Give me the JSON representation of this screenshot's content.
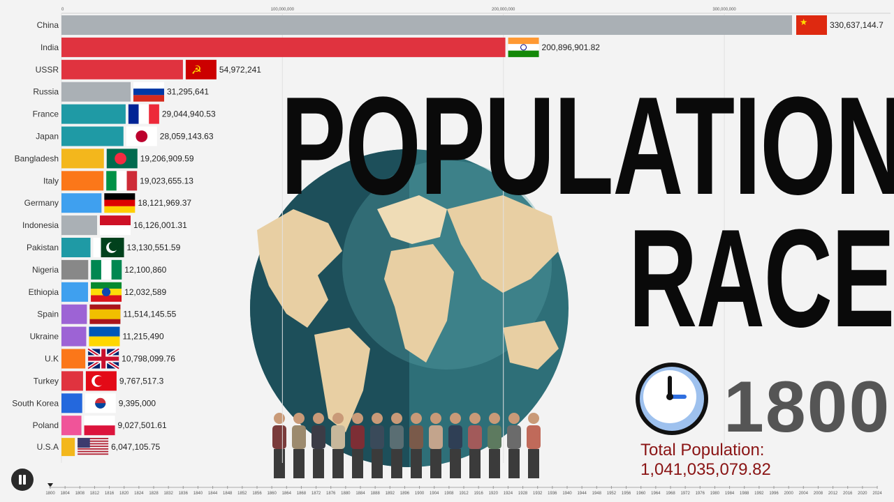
{
  "title": {
    "line1": "POPULATION",
    "line2": "RACE"
  },
  "year": "1800",
  "total_population": "Total Population: 1,041,035,079.82",
  "controls": {
    "pause_icon": "pause-icon"
  },
  "colors": {
    "grey": "#aab0b5",
    "red": "#e0333f",
    "teal": "#1f9aa5",
    "yellow": "#f3b71c",
    "orange": "#fb7719",
    "blue": "#3fa0ef",
    "purple": "#9d63d5",
    "pink": "#f05499",
    "darkgrey": "#888888",
    "royal": "#2468dd"
  },
  "chart_data": {
    "type": "bar",
    "orientation": "horizontal",
    "xlim": [
      0,
      370000000
    ],
    "x_ticks": [
      "0",
      "100,000,000",
      "200,000,000",
      "300,000,000"
    ],
    "timeline_years": [
      "1800",
      "1804",
      "1808",
      "1812",
      "1816",
      "1820",
      "1824",
      "1828",
      "1832",
      "1836",
      "1840",
      "1844",
      "1848",
      "1852",
      "1856",
      "1860",
      "1864",
      "1868",
      "1872",
      "1876",
      "1880",
      "1884",
      "1888",
      "1892",
      "1896",
      "1900",
      "1904",
      "1908",
      "1912",
      "1916",
      "1920",
      "1924",
      "1928",
      "1932",
      "1936",
      "1940",
      "1944",
      "1948",
      "1952",
      "1956",
      "1960",
      "1964",
      "1968",
      "1972",
      "1976",
      "1980",
      "1984",
      "1988",
      "1992",
      "1996",
      "2000",
      "2004",
      "2008",
      "2012",
      "2016",
      "2020",
      "2024"
    ],
    "categories": [
      "China",
      "India",
      "USSR",
      "Russia",
      "France",
      "Japan",
      "Bangladesh",
      "Italy",
      "Germany",
      "Indonesia",
      "Pakistan",
      "Nigeria",
      "Ethiopia",
      "Spain",
      "Ukraine",
      "U.K",
      "Turkey",
      "South Korea",
      "Poland",
      "U.S.A"
    ],
    "values": [
      330637144.7,
      200896901.82,
      54972241,
      31295641,
      29044940.53,
      28059143.63,
      19206909.59,
      19023655.13,
      18121969.37,
      16126001.31,
      13130551.59,
      12100860,
      12032589,
      11514145.55,
      11215490,
      10798099.76,
      9767517.3,
      9395000,
      9027501.61,
      6047105.75
    ],
    "value_labels": [
      "330,637,144.7",
      "200,896,901.82",
      "54,972,241",
      "31,295,641",
      "29,044,940.53",
      "28,059,143.63",
      "19,206,909.59",
      "19,023,655.13",
      "18,121,969.37",
      "16,126,001.31",
      "13,130,551.59",
      "12,100,860",
      "12,032,589",
      "11,514,145.55",
      "11,215,490",
      "10,798,099.76",
      "9,767,517.3",
      "9,395,000",
      "9,027,501.61",
      "6,047,105.75"
    ],
    "bar_colors": [
      "#aab0b5",
      "#e0333f",
      "#e0333f",
      "#aab0b5",
      "#1f9aa5",
      "#1f9aa5",
      "#f3b71c",
      "#fb7719",
      "#3fa0ef",
      "#aab0b5",
      "#1f9aa5",
      "#888888",
      "#3fa0ef",
      "#9d63d5",
      "#9d63d5",
      "#fb7719",
      "#e0333f",
      "#2468dd",
      "#f05499",
      "#f3b71c"
    ],
    "flags": [
      "china-flag",
      "india-flag",
      "ussr-flag",
      "russia-flag",
      "france-flag",
      "japan-flag",
      "bangladesh-flag",
      "italy-flag",
      "germany-flag",
      "indonesia-flag",
      "pakistan-flag",
      "nigeria-flag",
      "ethiopia-flag",
      "spain-flag",
      "ukraine-flag",
      "uk-flag",
      "turkey-flag",
      "south-korea-flag",
      "poland-flag",
      "usa-flag"
    ]
  }
}
